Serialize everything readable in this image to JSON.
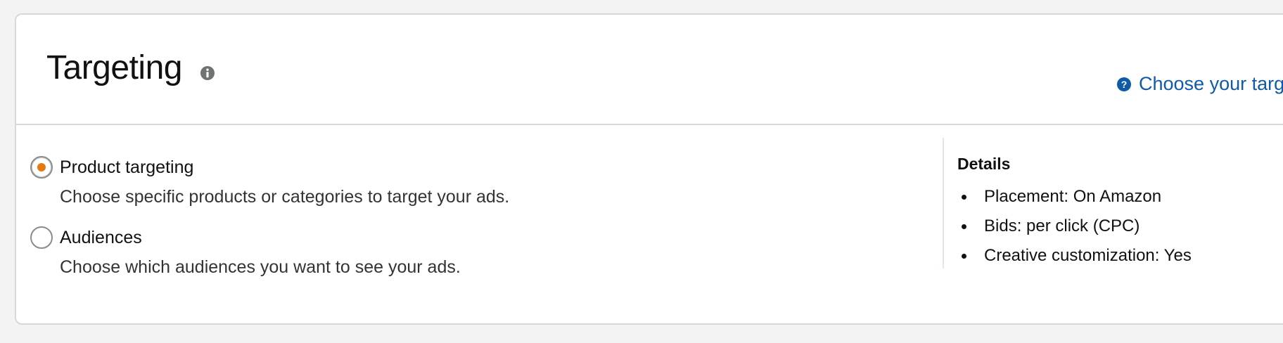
{
  "section": {
    "title": "Targeting",
    "help_link": "Choose your targ",
    "accent_color": "#e47911",
    "link_color": "#0f5ba7"
  },
  "options": [
    {
      "label": "Product targeting",
      "description": "Choose specific products or categories to target your ads.",
      "selected": true
    },
    {
      "label": "Audiences",
      "description": "Choose which audiences you want to see your ads.",
      "selected": false
    }
  ],
  "details": {
    "title": "Details",
    "items": [
      "Placement: On Amazon",
      "Bids: per click (CPC)",
      "Creative customization: Yes"
    ]
  },
  "icons": {
    "title_info": "info-icon",
    "help": "question-circle-icon"
  }
}
